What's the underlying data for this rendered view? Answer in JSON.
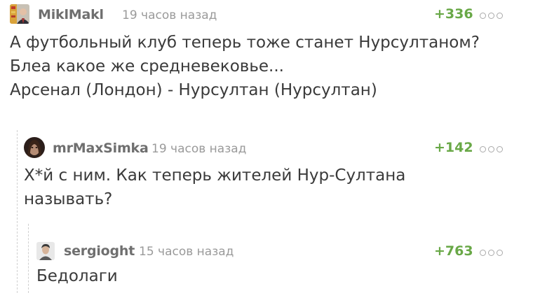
{
  "comments": [
    {
      "author": "MiklMakl",
      "time": "19 часов назад",
      "rating": "+336",
      "lines": [
        "А футбольный клуб теперь тоже станет Нурсултаном?",
        "Блеа какое же средневековье...",
        "Арсенал (Лондон) - Нурсултан (Нурсултан)"
      ]
    },
    {
      "author": "mrMaxSimka",
      "time": "19 часов назад",
      "rating": "+142",
      "lines": [
        "Х*й с ним. Как теперь жителей Нур-Султана",
        "называть?"
      ]
    },
    {
      "author": "sergioght",
      "time": "15 часов назад",
      "rating": "+763",
      "lines": [
        "Бедолаги"
      ]
    }
  ],
  "colors": {
    "rating": "#69a847",
    "author": "#6f6f6f",
    "time": "#9a9a9a",
    "text": "#3a3a3a"
  }
}
